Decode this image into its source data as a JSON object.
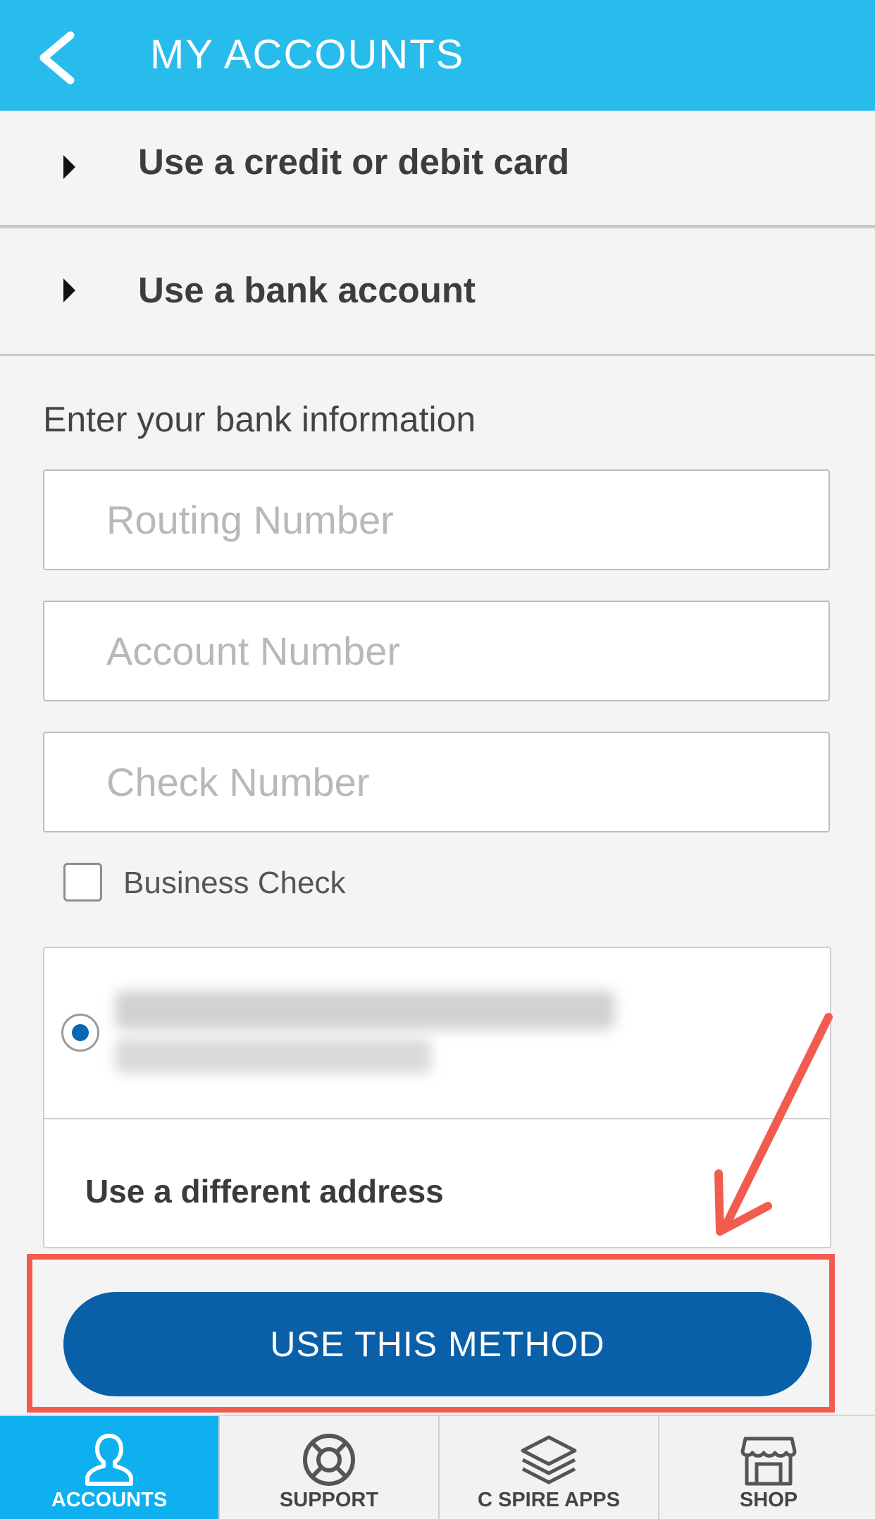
{
  "header": {
    "title": "MY ACCOUNTS",
    "back_icon": "chevron-left-icon"
  },
  "options": [
    {
      "label": "Use a credit or debit card"
    },
    {
      "label": "Use a bank account"
    }
  ],
  "bank_form": {
    "section_label": "Enter your bank information",
    "routing_placeholder": "Routing Number",
    "account_placeholder": "Account Number",
    "check_placeholder": "Check Number",
    "business_check_label": "Business Check",
    "different_address_label": "Use a different address",
    "submit_label": "USE THIS METHOD"
  },
  "tabs": [
    {
      "label": "ACCOUNTS",
      "icon": "person-icon",
      "active": true
    },
    {
      "label": "SUPPORT",
      "icon": "lifebuoy-icon",
      "active": false
    },
    {
      "label": "C SPIRE APPS",
      "icon": "layers-icon",
      "active": false
    },
    {
      "label": "SHOP",
      "icon": "storefront-icon",
      "active": false
    }
  ],
  "colors": {
    "header": "#27bcec",
    "primary_button": "#0960a8",
    "active_tab": "#0fb0ef",
    "annotation_red": "#f25c4f"
  }
}
